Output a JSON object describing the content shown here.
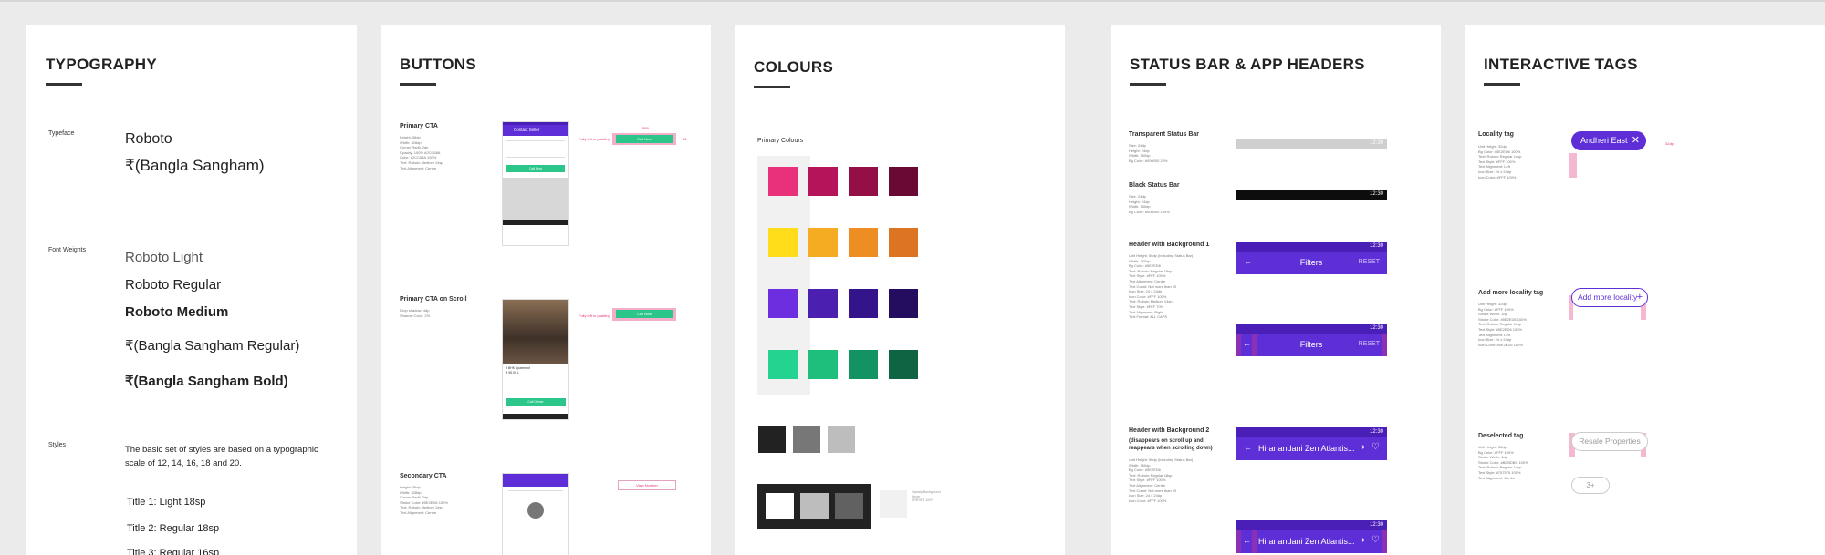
{
  "panels": {
    "typography": {
      "title": "TYPOGRAPHY",
      "typeface_label": "Typeface",
      "typeface_1": "Roboto",
      "typeface_2": "₹(Bangla Sangham)",
      "weights_label": "Font Weights",
      "weights": [
        "Roboto Light",
        "Roboto Regular",
        "Roboto Medium",
        "₹(Bangla Sangham Regular)",
        "₹(Bangla Sangham Bold)"
      ],
      "styles_label": "Styles",
      "styles_desc": "The basic set of styles are based on a typographic scale of 12, 14, 16, 18 and 20.",
      "style_items": [
        "Title 1: Light 18sp",
        "Title 2: Regular 18sp",
        "Title 3: Regular 16sp"
      ]
    },
    "buttons": {
      "title": "BUTTONS",
      "primary_cta": "Primary CTA",
      "primary_cta_scroll": "Primary CTA on Scroll",
      "secondary_cta": "Secondary CTA",
      "contact_seller": "Contact Seller",
      "call_now": "Call Now",
      "call_owner": "Call Owner",
      "view_number": "View Number",
      "full_width_padding": "Fully left to padding"
    },
    "colours": {
      "title": "COLOURS",
      "primary_colours": "Primary Colours"
    },
    "status": {
      "title": "STATUS BAR & APP HEADERS",
      "transparent": "Transparent Status Bar",
      "black": "Black Status Bar",
      "header_bg1": "Header with Background 1",
      "header_bg2": "Header with Background 2",
      "header_bg2_sub": "(disappears on scroll up and reappears when scrolling down)",
      "time": "12:30",
      "filters": "Filters",
      "reset": "RESET",
      "project": "Hiranandani Zen Atlantis..."
    },
    "tags": {
      "title": "INTERACTIVE TAGS",
      "locality_tag": "Locality tag",
      "locality_value": "Andheri East",
      "add_more": "Add more locality tag",
      "add_more_value": "Add more locality",
      "deselected": "Deselected tag",
      "deselected_value": "Resale Properties",
      "count_value": "3+"
    }
  },
  "colors": {
    "purple": "#5e2ed6",
    "green": "#2cc68a",
    "pink": "#e2347a"
  },
  "swatches": [
    [
      "#e8317a",
      "#b5135a",
      "#930f45",
      "#6a0a33"
    ],
    [
      "#ffdd1a",
      "#f5ab22",
      "#ee8d22",
      "#dd7422"
    ],
    [
      "#6d2ee0",
      "#4b1fb0",
      "#33148a",
      "#240d5e"
    ],
    [
      "#25d391",
      "#1ebe7c",
      "#139364",
      "#0f6443"
    ]
  ],
  "greys": [
    "#222222",
    "#777777",
    "#bdbdbd"
  ]
}
